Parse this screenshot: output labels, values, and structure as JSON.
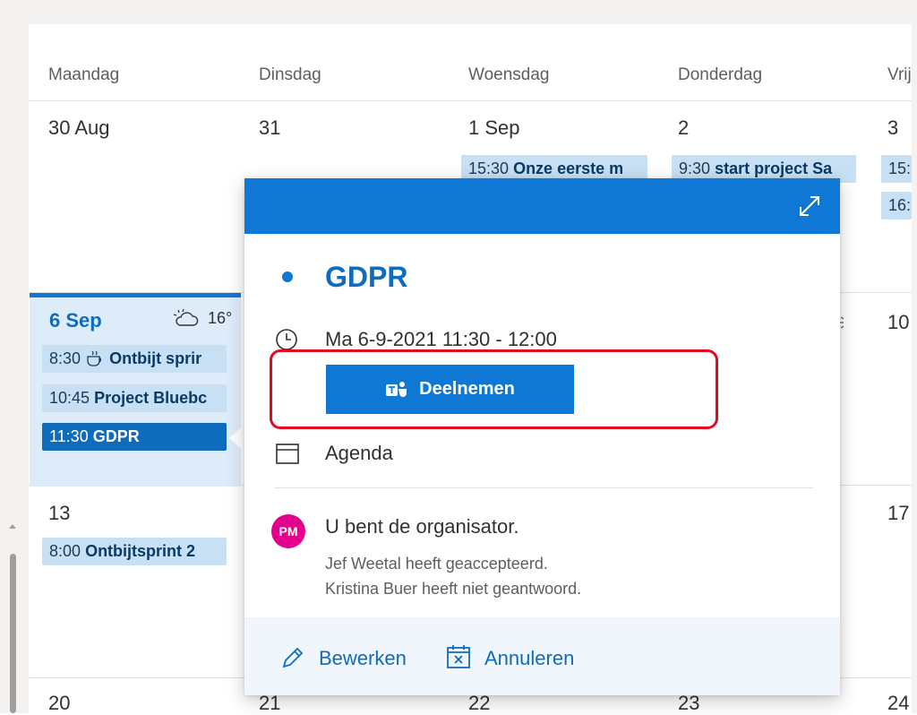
{
  "calendar": {
    "days": [
      "Maandag",
      "Dinsdag",
      "Woensdag",
      "Donderdag",
      "Vrij"
    ],
    "week1": {
      "dates": [
        "30 Aug",
        "31",
        "1 Sep",
        "2",
        "3"
      ],
      "events": {
        "wed": {
          "time": "15:30",
          "title": "Onze eerste m"
        },
        "thu": {
          "time": "9:30",
          "title": "start project Sa"
        },
        "fri1": {
          "time": "15:"
        },
        "fri2": {
          "time": "16:"
        }
      }
    },
    "week2": {
      "dates": [
        "6 Sep",
        "10"
      ],
      "weather": "16°",
      "events": [
        {
          "time": "8:30",
          "title": "Ontbijt sprir"
        },
        {
          "time": "10:45",
          "title": "Project Bluebc"
        },
        {
          "time": "11:30",
          "title": "GDPR"
        }
      ]
    },
    "week3": {
      "dates": [
        "13",
        "17"
      ],
      "events": [
        {
          "time": "8:00",
          "title": "Ontbijtsprint 2"
        }
      ]
    },
    "week4": {
      "dates": [
        "20",
        "21",
        "22",
        "23",
        "24"
      ]
    }
  },
  "popup": {
    "title": "GDPR",
    "datetime": "Ma 6-9-2021 11:30 - 12:00",
    "join_label": "Deelnemen",
    "calendar_name": "Agenda",
    "avatar_initials": "PM",
    "organizer_text": "U bent de organisator.",
    "responses": [
      "Jef Weetal heeft geaccepteerd.",
      "Kristina Buer heeft niet geantwoord."
    ],
    "edit_label": "Bewerken",
    "cancel_label": "Annuleren"
  },
  "colors": {
    "accent": "#0f78d4",
    "event_bg": "#c7e0f4",
    "today_bg": "#deecf9",
    "avatar": "#e3008c",
    "highlight_outline": "#e00b1c"
  }
}
